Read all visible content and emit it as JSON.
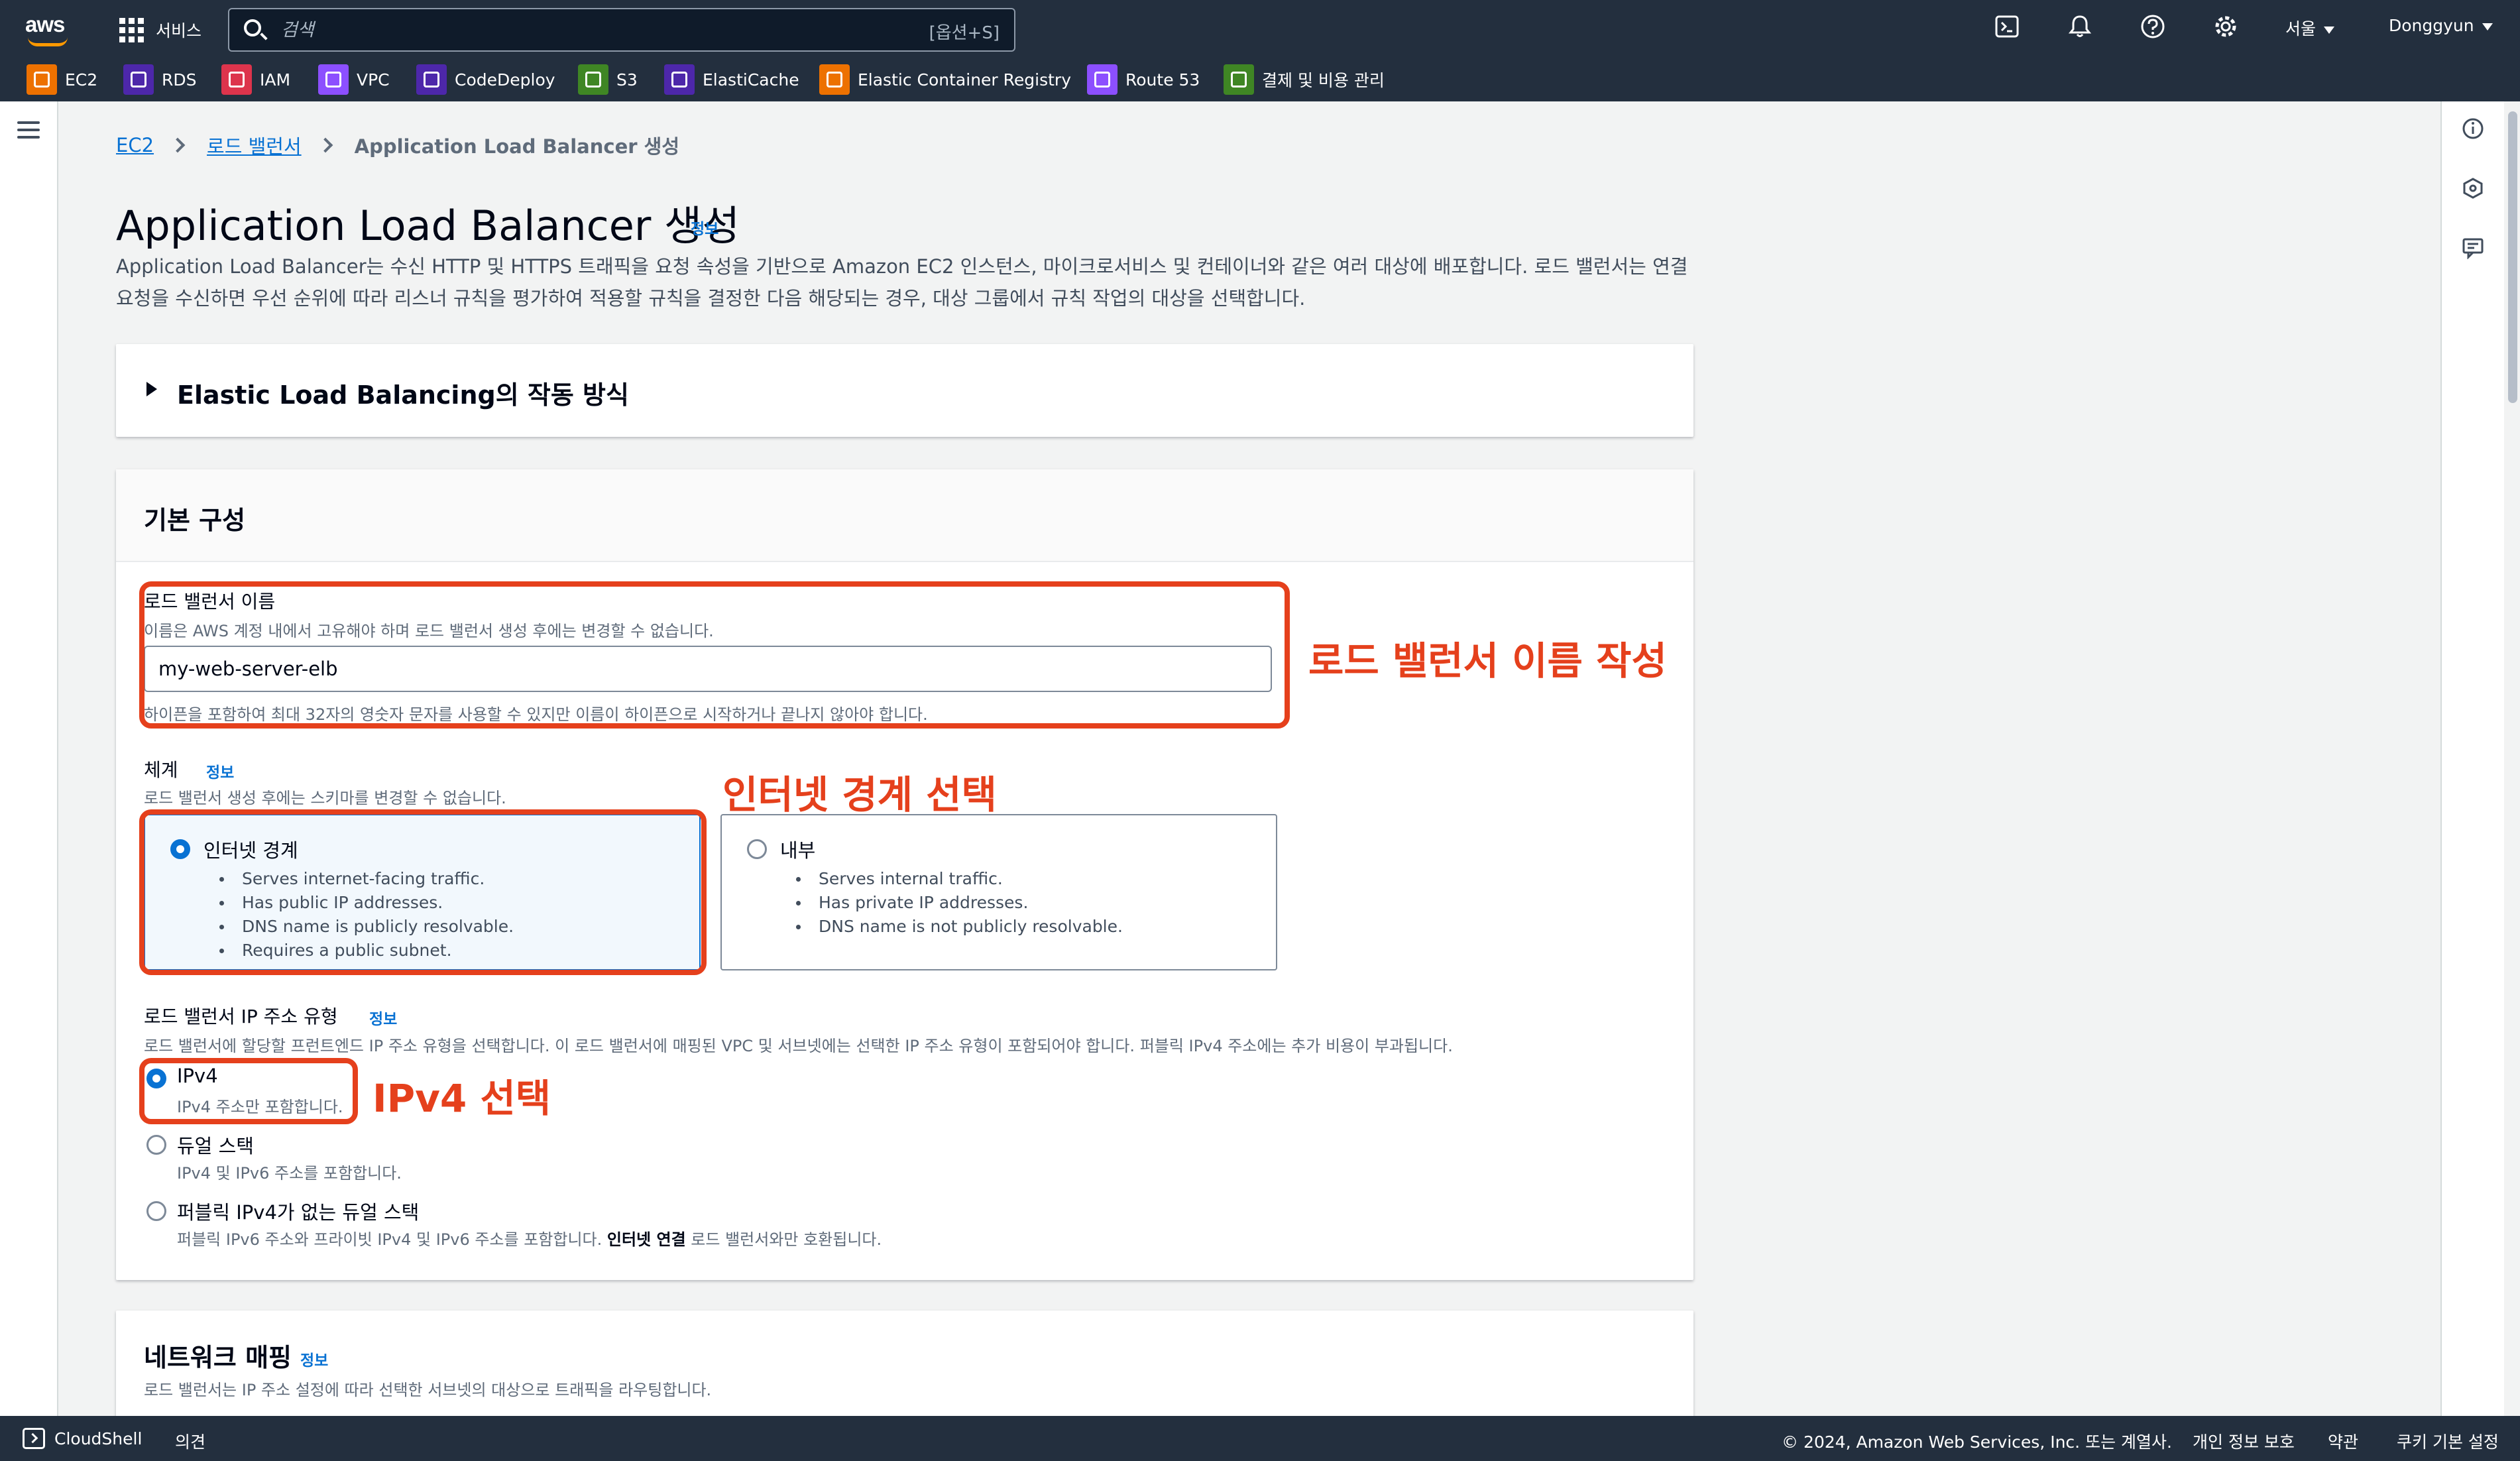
{
  "topnav": {
    "logo": "aws",
    "services_label": "서비스",
    "search_placeholder": "검색",
    "search_shortcut": "[옵션+S]",
    "region": "서울",
    "user": "Donggyun",
    "icons": [
      "cloudshell-icon",
      "bell-icon",
      "help-icon",
      "settings-icon"
    ]
  },
  "favorites": [
    {
      "label": "EC2",
      "color": "#ed7100"
    },
    {
      "label": "RDS",
      "color": "#4d27aa"
    },
    {
      "label": "IAM",
      "color": "#dd344c"
    },
    {
      "label": "VPC",
      "color": "#8c4fff"
    },
    {
      "label": "CodeDeploy",
      "color": "#4d27aa"
    },
    {
      "label": "S3",
      "color": "#3f8624"
    },
    {
      "label": "ElastiCache",
      "color": "#4d27aa"
    },
    {
      "label": "Elastic Container Registry",
      "color": "#ed7100"
    },
    {
      "label": "Route 53",
      "color": "#8c4fff"
    },
    {
      "label": "결제 및 비용 관리",
      "color": "#3f8624"
    }
  ],
  "breadcrumb": {
    "item1": "EC2",
    "item2": "로드 밸런서",
    "current": "Application Load Balancer 생성"
  },
  "page": {
    "title": "Application Load Balancer 생성",
    "info": "정보",
    "description": "Application Load Balancer는 수신 HTTP 및 HTTPS 트래픽을 요청 속성을 기반으로 Amazon EC2 인스턴스, 마이크로서비스 및 컨테이너와 같은 여러 대상에 배포합니다. 로드 밸런서는 연결 요청을 수신하면 우선 순위에 따라 리스너 규칙을 평가하여 적용할 규칙을 결정한 다음 해당되는 경우, 대상 그룹에서 규칙 작업의 대상을 선택합니다."
  },
  "elb_panel": {
    "title": "Elastic Load Balancing의 작동 방식"
  },
  "basic": {
    "title": "기본 구성",
    "name_label": "로드 밸런서 이름",
    "name_desc": "이름은 AWS 계정 내에서 고유해야 하며 로드 밸런서 생성 후에는 변경할 수 없습니다.",
    "name_value": "my-web-server-elb",
    "name_hint": "하이픈을 포함하여 최대 32자의 영숫자 문자를 사용할 수 있지만 이름이 하이픈으로 시작하거나 끝나지 않아야 합니다.",
    "scheme_label": "체계",
    "scheme_info": "정보",
    "scheme_desc": "로드 밸런서 생성 후에는 스키마를 변경할 수 없습니다.",
    "scheme_options": [
      {
        "label": "인터넷 경계",
        "selected": true,
        "bullets": [
          "Serves internet-facing traffic.",
          "Has public IP addresses.",
          "DNS name is publicly resolvable.",
          "Requires a public subnet."
        ]
      },
      {
        "label": "내부",
        "selected": false,
        "bullets": [
          "Serves internal traffic.",
          "Has private IP addresses.",
          "DNS name is not publicly resolvable."
        ]
      }
    ],
    "ip_label": "로드 밸런서 IP 주소 유형",
    "ip_info": "정보",
    "ip_desc": "로드 밸런서에 할당할 프런트엔드 IP 주소 유형을 선택합니다. 이 로드 밸런서에 매핑된 VPC 및 서브넷에는 선택한 IP 주소 유형이 포함되어야 합니다. 퍼블릭 IPv4 주소에는 추가 비용이 부과됩니다.",
    "ip_options": [
      {
        "label": "IPv4",
        "desc": "IPv4 주소만 포함합니다.",
        "selected": true
      },
      {
        "label": "듀얼 스택",
        "desc": "IPv4 및 IPv6 주소를 포함합니다.",
        "selected": false
      },
      {
        "label": "퍼블릭 IPv4가 없는 듀얼 스택",
        "desc_pre": "퍼블릭 IPv6 주소와 프라이빗 IPv4 및 IPv6 주소를 포함합니다. ",
        "desc_bold": "인터넷 연결",
        "desc_post": " 로드 밸런서와만 호환됩니다.",
        "selected": false
      }
    ]
  },
  "network": {
    "title": "네트워크 매핑",
    "info": "정보",
    "desc": "로드 밸런서는 IP 주소 설정에 따라 선택한 서브넷의 대상으로 트래픽을 라우팅합니다."
  },
  "annotations": {
    "name": "로드 밸런서 이름 작성",
    "scheme": "인터넷 경계 선택",
    "ip": "IPv4 선택",
    "color": "#e5401c"
  },
  "footer": {
    "cloudshell": "CloudShell",
    "feedback": "의견",
    "copyright": "© 2024, Amazon Web Services, Inc. 또는 계열사.",
    "privacy": "개인 정보 보호",
    "terms": "약관",
    "cookies": "쿠키 기본 설정"
  }
}
